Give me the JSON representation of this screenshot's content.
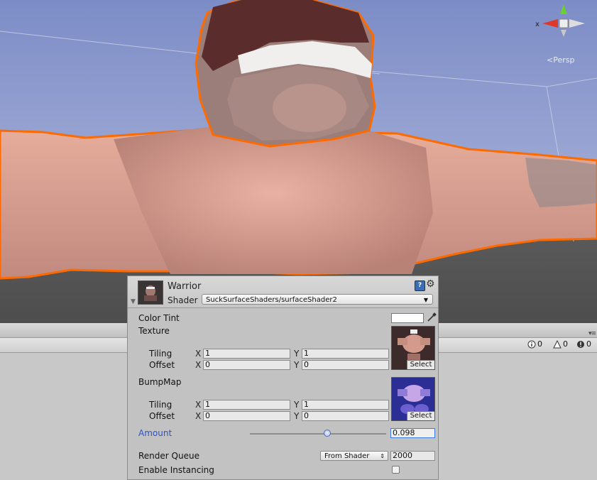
{
  "scene": {
    "view_mode": "Persp",
    "gizmo_axis_label": "x",
    "colors": {
      "sky": "#8292c9",
      "ground": "#575757",
      "skin": "#dca291",
      "outline": "#ff6a00"
    }
  },
  "console": {
    "info_count": "0",
    "warning_count": "0",
    "error_count": "0"
  },
  "inspector": {
    "material_name": "Warrior",
    "shader_label": "Shader",
    "shader_value": "SuckSurfaceShaders/surfaceShader2",
    "properties": {
      "color_tint_label": "Color Tint",
      "color_tint_value": "#ffffff",
      "texture_label": "Texture",
      "texture": {
        "tiling_label": "Tiling",
        "offset_label": "Offset",
        "x_label": "X",
        "y_label": "Y",
        "tiling_x": "1",
        "tiling_y": "1",
        "offset_x": "0",
        "offset_y": "0",
        "select_label": "Select"
      },
      "bumpmap_label": "BumpMap",
      "bumpmap": {
        "tiling_label": "Tiling",
        "offset_label": "Offset",
        "x_label": "X",
        "y_label": "Y",
        "tiling_x": "1",
        "tiling_y": "1",
        "offset_x": "0",
        "offset_y": "0",
        "select_label": "Select"
      },
      "amount_label": "Amount",
      "amount_value": "0.098",
      "amount_slider_fraction": 0.57,
      "render_queue_label": "Render Queue",
      "render_queue_option": "From Shader",
      "render_queue_value": "2000",
      "instancing_label": "Enable Instancing",
      "instancing_checked": false
    }
  }
}
